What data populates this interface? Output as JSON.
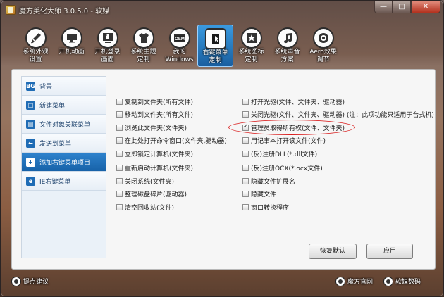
{
  "window": {
    "title": "魔方美化大师 3.0.5.0 - 软媒",
    "buttons": {
      "minimize": "—",
      "restore": "□",
      "close": "✕"
    }
  },
  "toolbar": {
    "items": [
      {
        "line1": "系统外观",
        "line2": "设置",
        "icon": "brush-icon"
      },
      {
        "line1": "开机动画",
        "line2": "",
        "icon": "monitor-icon"
      },
      {
        "line1": "开机登录",
        "line2": "画面",
        "icon": "login-screen-icon"
      },
      {
        "line1": "系统主题",
        "line2": "定制",
        "icon": "shirt-icon"
      },
      {
        "line1": "我的",
        "line2": "Windows",
        "icon": "oem-icon"
      },
      {
        "line1": "右键菜单",
        "line2": "定制",
        "icon": "cursor-menu-icon"
      },
      {
        "line1": "系统图标",
        "line2": "定制",
        "icon": "star-icon"
      },
      {
        "line1": "系统声音",
        "line2": "方案",
        "icon": "music-note-icon"
      },
      {
        "line1": "Aero效果",
        "line2": "调节",
        "icon": "aero-icon"
      }
    ],
    "oem_badge": "OEM",
    "active_index": 5
  },
  "sidebar": {
    "items": [
      {
        "label": "背景",
        "badge": "BG"
      },
      {
        "label": "新建菜单",
        "badge": "□"
      },
      {
        "label": "文件对象关联菜单",
        "badge": "▤"
      },
      {
        "label": "发送到菜单",
        "badge": "←"
      },
      {
        "label": "添加右键菜单项目",
        "badge": "+"
      },
      {
        "label": "IE右键菜单",
        "badge": "e"
      }
    ],
    "active_index": 4
  },
  "options": {
    "left": [
      {
        "label": "复制到文件夹(所有文件)",
        "checked": false
      },
      {
        "label": "移动到文件夹(所有文件)",
        "checked": false
      },
      {
        "label": "浏览此文件夹(文件夹)",
        "checked": false
      },
      {
        "label": "在此处打开命令窗口(文件夹,驱动器)",
        "checked": false
      },
      {
        "label": "立即锁定计算机(文件夹)",
        "checked": false
      },
      {
        "label": "重新启动计算机(文件夹)",
        "checked": false
      },
      {
        "label": "关闭系统(文件夹)",
        "checked": false
      },
      {
        "label": "整理磁盘碎片(驱动器)",
        "checked": false
      },
      {
        "label": "清空回收站(文件)",
        "checked": false
      }
    ],
    "right": [
      {
        "label": "打开光驱(文件、文件夹、驱动器)",
        "checked": false
      },
      {
        "label": "关闭光驱(文件、文件夹、驱动器) (注：此项功能只适用于台式机)",
        "checked": false
      },
      {
        "label": "管理员取得所有权(文件、文件夹)",
        "checked": true
      },
      {
        "label": "用记事本打开该文件(文件)",
        "checked": false
      },
      {
        "label": "(反)注册DLL(*.dll文件)",
        "checked": false
      },
      {
        "label": "(反)注册OCX(*.ocx文件)",
        "checked": false
      },
      {
        "label": "隐藏文件扩展名",
        "checked": false
      },
      {
        "label": "隐藏文件",
        "checked": false
      },
      {
        "label": "窗口转换程序",
        "checked": false
      }
    ]
  },
  "buttons": {
    "restore_default": "恢复默认",
    "apply": "应用"
  },
  "statusbar": {
    "feedback": "提点建议",
    "official_site": "魔方官网",
    "software_media": "软媒数码"
  },
  "colors": {
    "accent": "#1f6cb5",
    "highlight_circle": "#d91c1c"
  }
}
